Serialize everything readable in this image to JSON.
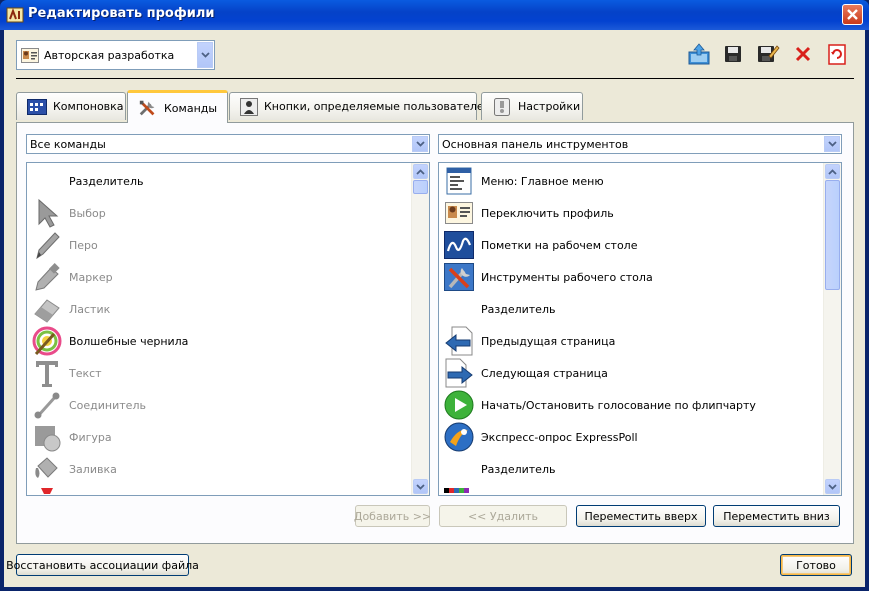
{
  "window": {
    "title": "Редактировать профили"
  },
  "profile": {
    "selected": "Авторская разработка"
  },
  "toolbar": {
    "icons": [
      "export-profile-icon",
      "save-icon",
      "save-as-icon",
      "delete-profile-icon",
      "reset-icon"
    ]
  },
  "tabs": [
    {
      "label": "Компоновка",
      "icon": "layout-icon"
    },
    {
      "label": "Команды",
      "icon": "tools-icon"
    },
    {
      "label": "Кнопки, определяемые пользователем",
      "icon": "user-button-icon"
    },
    {
      "label": "Настройки",
      "icon": "settings-icon"
    }
  ],
  "commands_filter": {
    "selected": "Все команды"
  },
  "toolbar_target": {
    "selected": "Основная панель инструментов"
  },
  "commands": [
    {
      "label": "Разделитель",
      "icon": "none",
      "enabled": true
    },
    {
      "label": "Выбор",
      "icon": "select-arrow-icon",
      "enabled": false
    },
    {
      "label": "Перо",
      "icon": "pen-icon",
      "enabled": false
    },
    {
      "label": "Маркер",
      "icon": "marker-icon",
      "enabled": false
    },
    {
      "label": "Ластик",
      "icon": "eraser-icon",
      "enabled": false
    },
    {
      "label": "Волшебные чернила",
      "icon": "magic-ink-icon",
      "enabled": true
    },
    {
      "label": "Текст",
      "icon": "text-icon",
      "enabled": false
    },
    {
      "label": "Соединитель",
      "icon": "connector-icon",
      "enabled": false
    },
    {
      "label": "Фигура",
      "icon": "shape-icon",
      "enabled": false
    },
    {
      "label": "Заливка",
      "icon": "fill-icon",
      "enabled": false
    }
  ],
  "toolbar_items": [
    {
      "label": "Меню: Главное меню",
      "icon": "main-menu-icon"
    },
    {
      "label": "Переключить профиль",
      "icon": "switch-profile-icon"
    },
    {
      "label": "Пометки на рабочем столе",
      "icon": "desktop-annotate-icon"
    },
    {
      "label": "Инструменты рабочего стола",
      "icon": "desktop-tools-icon"
    },
    {
      "label": "Разделитель",
      "icon": "none"
    },
    {
      "label": "Предыдущая страница",
      "icon": "previous-page-icon"
    },
    {
      "label": "Следующая страница",
      "icon": "next-page-icon"
    },
    {
      "label": "Начать/Остановить голосование по флипчарту",
      "icon": "play-vote-icon"
    },
    {
      "label": "Экспресс-опрос ExpressPoll",
      "icon": "expresspoll-icon"
    },
    {
      "label": "Разделитель",
      "icon": "none"
    }
  ],
  "buttons": {
    "add": "Добавить >>",
    "remove": "<< Удалить",
    "move_up": "Переместить вверх",
    "move_down": "Переместить вниз",
    "restore": "Восстановить ассоциации файла",
    "done": "Готово"
  },
  "colors": {
    "titlebar": "#0542C8",
    "tab_highlight": "#FFC83C",
    "dialog_bg": "#ECE9D8"
  }
}
